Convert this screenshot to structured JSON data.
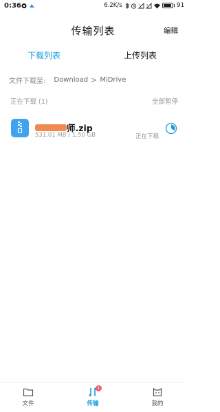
{
  "status_bar": {
    "time": "0:36",
    "network_speed": "6.2K/s",
    "battery_text": "91",
    "battery_level": 0.91,
    "icons": [
      "notification-icon",
      "notification-icon-2",
      "bluetooth-icon",
      "alarm-icon",
      "signal-icon",
      "signal-icon-2",
      "wifi-icon",
      "battery-icon"
    ]
  },
  "header": {
    "title": "传输列表",
    "edit_label": "编辑"
  },
  "tabs": [
    {
      "label": "下载列表",
      "active": true
    },
    {
      "label": "上传列表",
      "active": false
    }
  ],
  "path": {
    "prefix": "文件下载至:",
    "segments": [
      "Download",
      "MiDrive"
    ],
    "separator": ">"
  },
  "section": {
    "title": "正在下载 (1)",
    "pause_all_label": "全部暂停"
  },
  "downloads": [
    {
      "name_visible": "师.zip",
      "size_text": "531.01 MB / 1.50 GB",
      "status": "正在下载",
      "progress": 0.35,
      "icon": "zip-file-icon"
    }
  ],
  "bottom_nav": [
    {
      "label": "文件",
      "icon": "folder-icon"
    },
    {
      "label": "传输",
      "icon": "transfer-icon",
      "badge": "1",
      "active": true
    },
    {
      "label": "我的",
      "icon": "profile-icon"
    }
  ],
  "colors": {
    "accent": "#1a9cdf",
    "file_icon_bg": "#3fa3f0",
    "badge": "#f25a6a",
    "redaction": "#f08a4e"
  }
}
